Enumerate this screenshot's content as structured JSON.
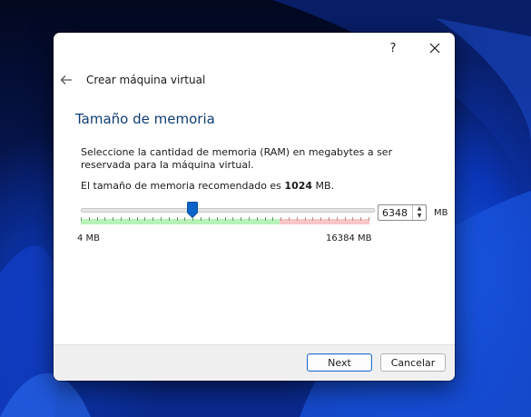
{
  "window": {
    "help_label": "?",
    "wizard_title": "Crear máquina virtual"
  },
  "page": {
    "title": "Tamaño de memoria",
    "description": "Seleccione la cantidad de memoria (RAM) en megabytes a ser reservada para la máquina virtual.",
    "recommend_prefix": "El tamaño de memoria recomendado es",
    "recommend_value": "1024",
    "recommend_suffix": "MB."
  },
  "memory": {
    "value": "6348",
    "value_mb": 6348,
    "min_mb": 4,
    "max_mb": 16384,
    "safe_limit_mb": 11264,
    "min_label": "4 MB",
    "max_label": "16384 MB",
    "unit": "MB"
  },
  "buttons": {
    "next": "Next",
    "cancel": "Cancelar"
  },
  "colors": {
    "title_blue": "#0f3e75",
    "thumb_blue": "#0a64c8",
    "safe_green": "#b8f2b8",
    "warn_red": "#f8c6c6"
  },
  "icons": {
    "back": "arrow-left-icon",
    "close": "close-icon",
    "spin_up": "triangle-up-icon",
    "spin_down": "triangle-down-icon"
  }
}
